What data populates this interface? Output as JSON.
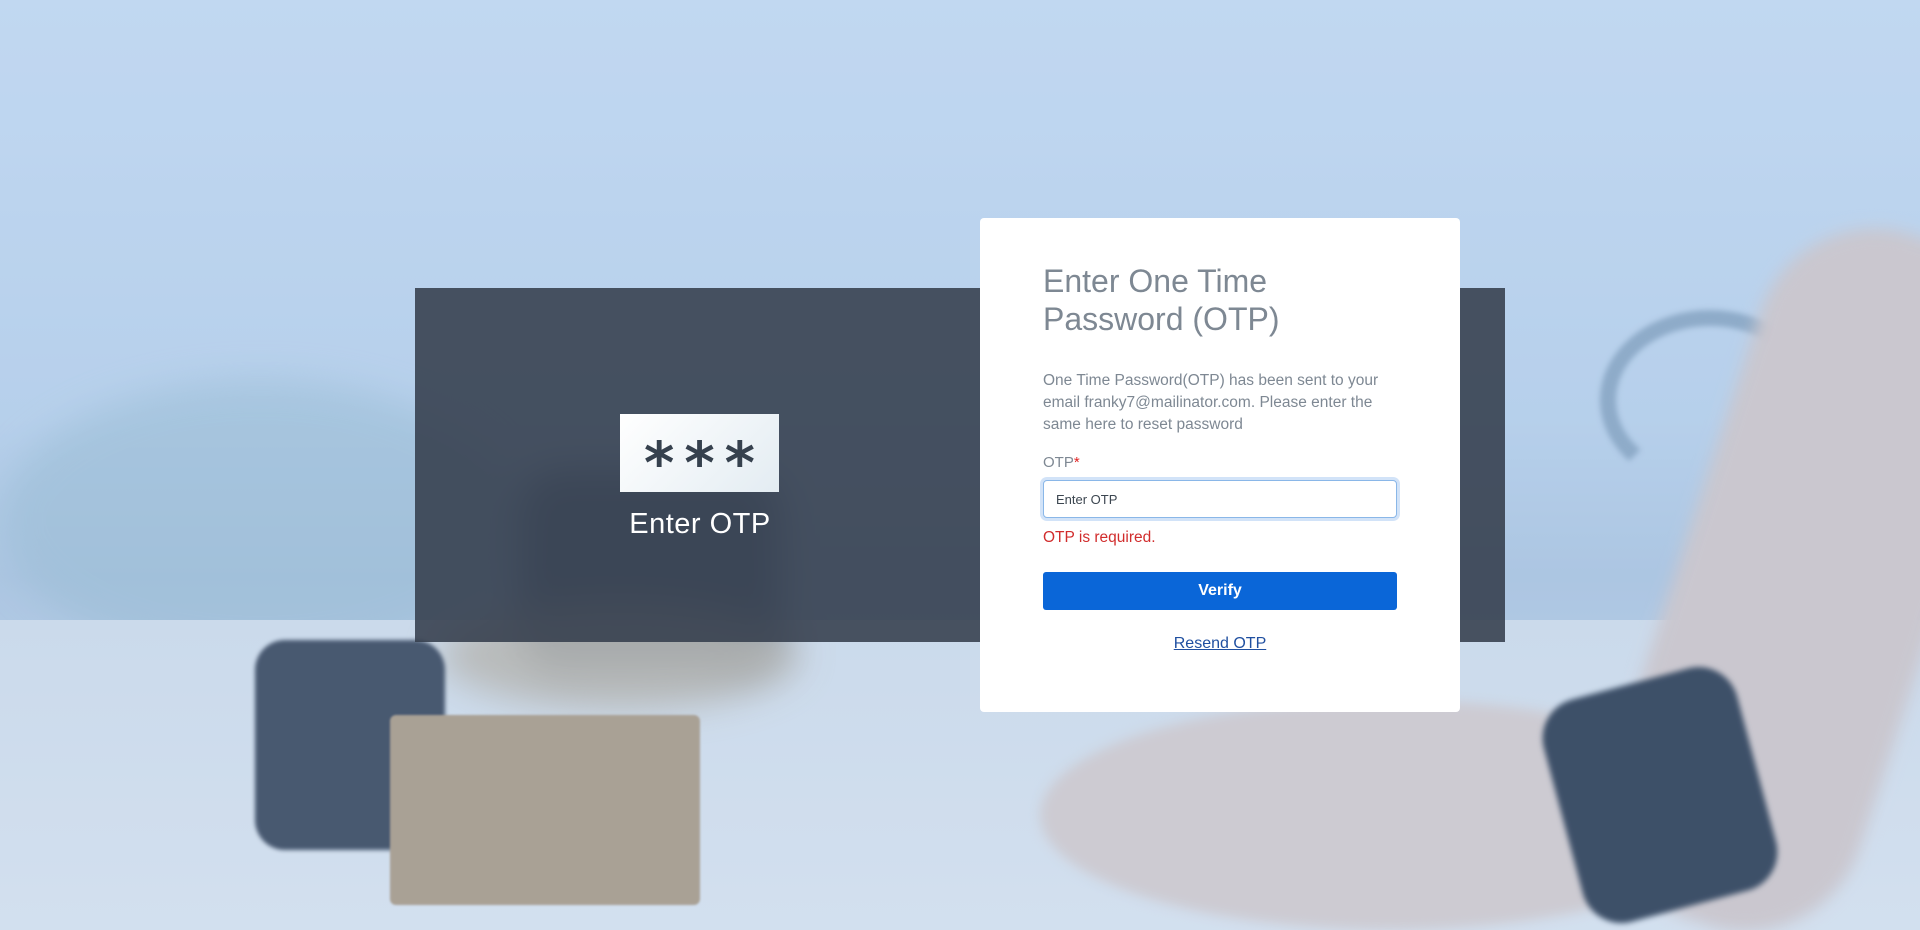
{
  "hero": {
    "badge_symbols": "***",
    "caption": "Enter OTP"
  },
  "card": {
    "title": "Enter One Time Password (OTP)",
    "description": "One Time Password(OTP) has been sent to your email franky7@mailinator.com. Please enter the same here to reset password",
    "otp_label": "OTP",
    "required_marker": "*",
    "otp_placeholder": "Enter OTP",
    "otp_value": "",
    "error_message": "OTP is required.",
    "verify_label": "Verify",
    "resend_label": "Resend OTP"
  },
  "colors": {
    "primary_button": "#0a66d8",
    "error": "#d12c2c",
    "link": "#1f4fa0",
    "panel": "#343e4c"
  }
}
